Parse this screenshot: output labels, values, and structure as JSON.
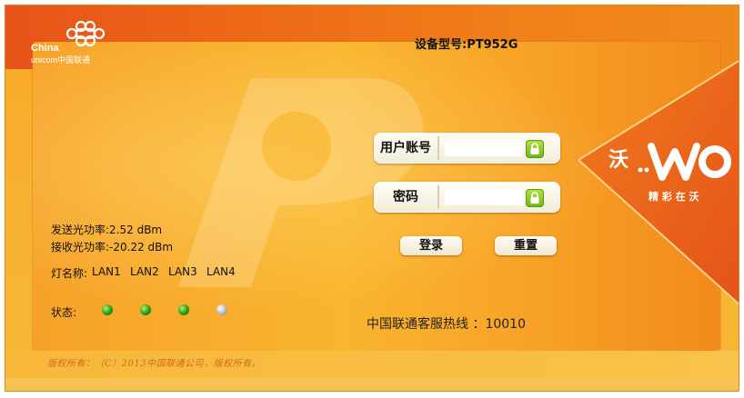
{
  "header": {
    "logo_en_line1": "China",
    "logo_en_line2": "unicom中国联通",
    "device_model": "设备型号:PT952G"
  },
  "login": {
    "username_label": "用户账号",
    "username_value": "",
    "password_label": "密码",
    "password_value": "",
    "login_button": "登录",
    "reset_button": "重置"
  },
  "optical": {
    "tx_power": "发送光功率:2.52 dBm",
    "rx_power": "接收光功率:-20.22 dBm"
  },
  "lights": {
    "name_label": "灯名称:",
    "names": [
      "LAN1",
      "LAN2",
      "LAN3",
      "LAN4"
    ],
    "status_label": "状态:",
    "states": [
      "green",
      "green",
      "green",
      "grey"
    ]
  },
  "brand": {
    "wo_prefix": "沃",
    "slogan": "精 彩 在 沃"
  },
  "hotline": "中国联通客服热线 ：10010",
  "footer": "版权所有：（C）2013中国联通公司，版权所有。",
  "colors": {
    "header_red": "#e8531a",
    "panel_orange": "#f9b52e",
    "led_on": "#2a9a10",
    "led_off": "#b8b8b8",
    "lock_green": "#6fb51b"
  }
}
